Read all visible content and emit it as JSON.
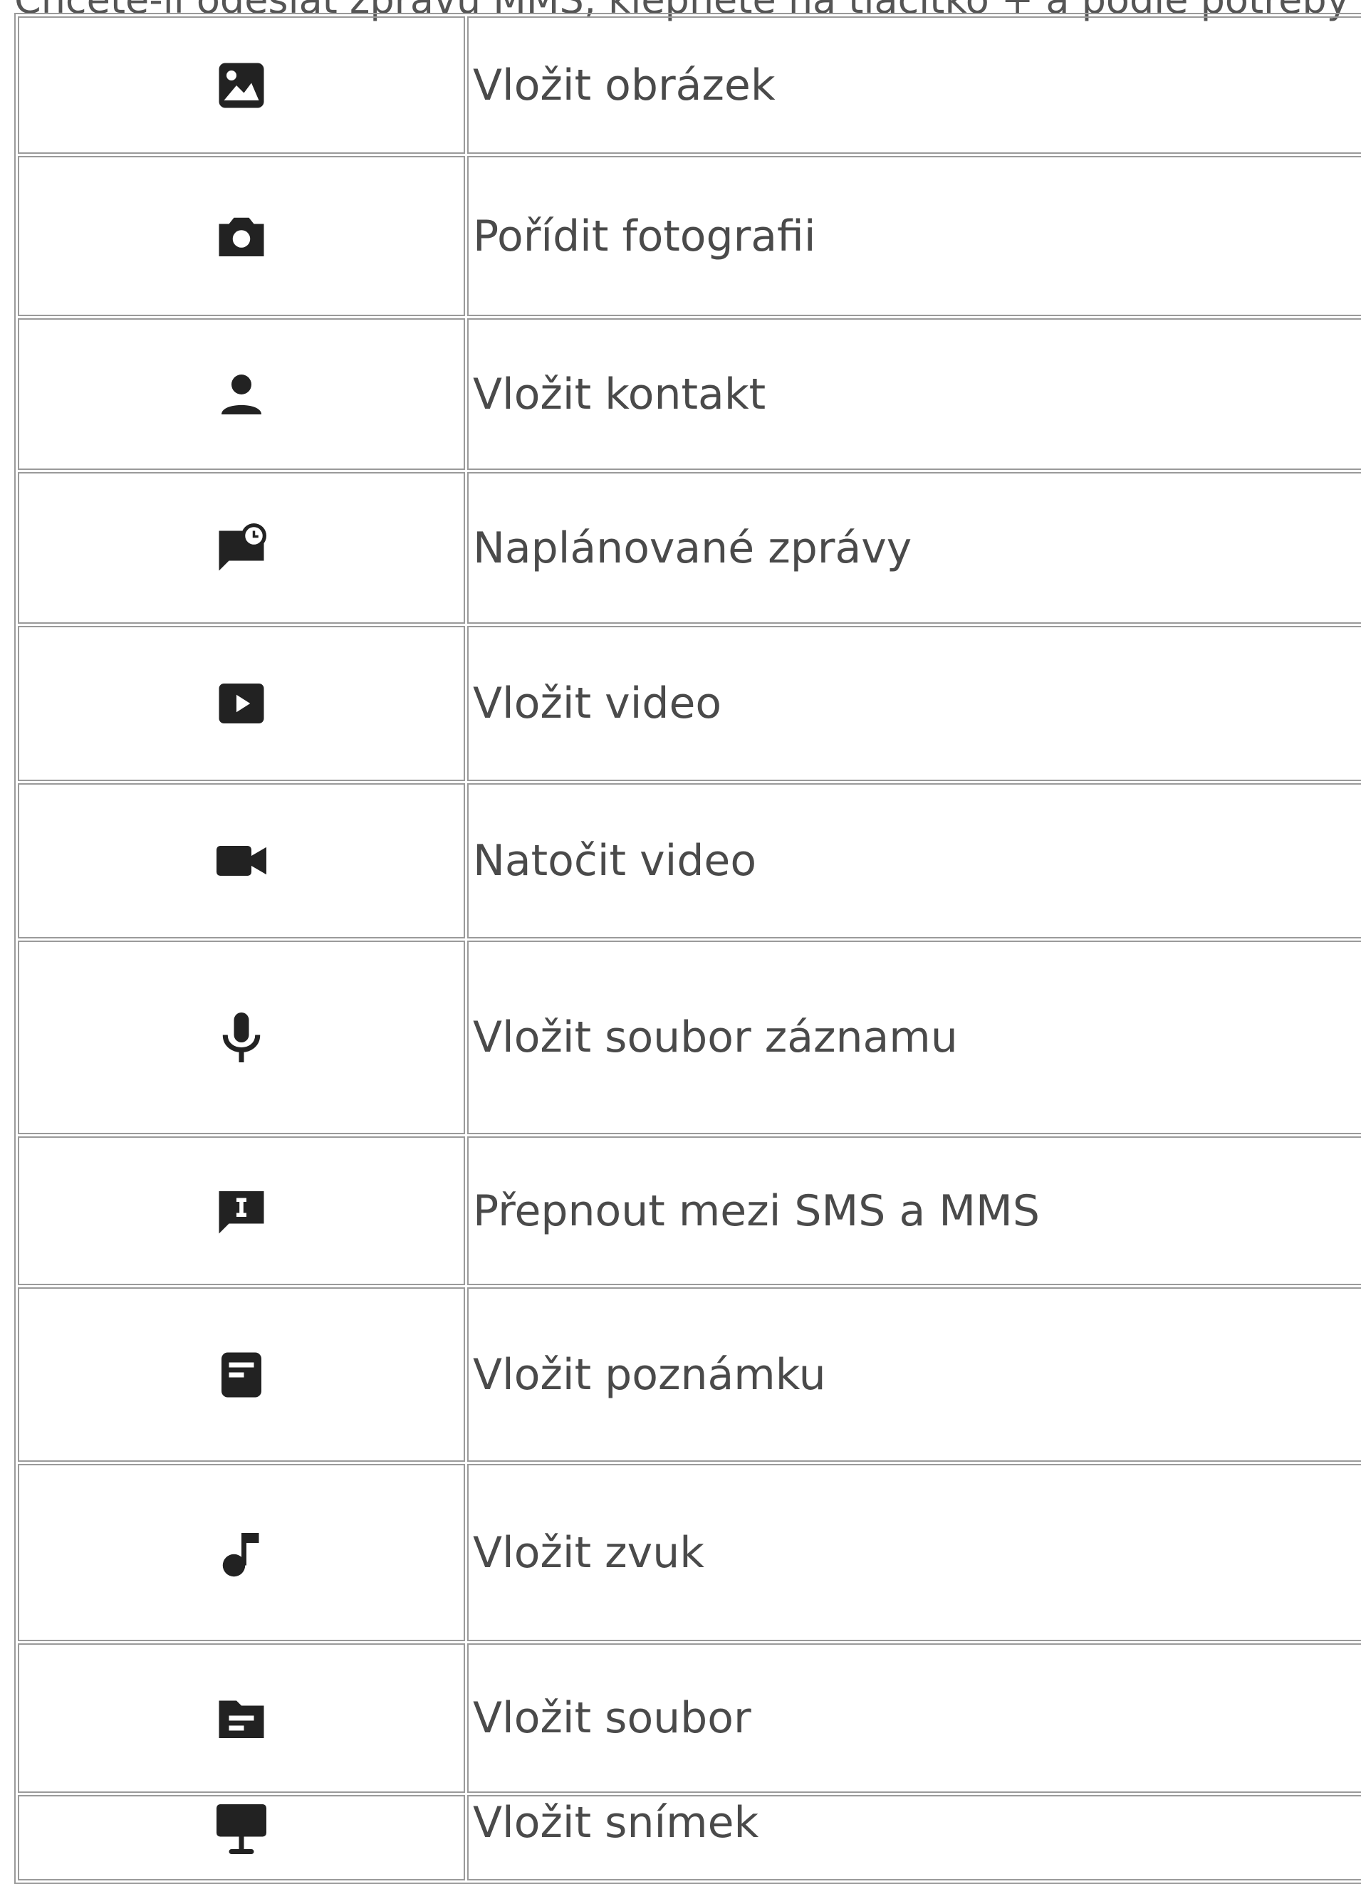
{
  "intro_text": "Chcete-li odeslat zprávu MMS, klepněte na tlačítko + a podle potřeby",
  "rows": [
    {
      "icon": "image-icon",
      "label": "Vložit obrázek"
    },
    {
      "icon": "camera-icon",
      "label": "Pořídit fotografii"
    },
    {
      "icon": "person-icon",
      "label": "Vložit kontakt"
    },
    {
      "icon": "scheduled-message-icon",
      "label": "Naplánované zprávy"
    },
    {
      "icon": "video-play-icon",
      "label": "Vložit video"
    },
    {
      "icon": "videocam-icon",
      "label": "Natočit video"
    },
    {
      "icon": "microphone-icon",
      "label": "Vložit soubor záznamu"
    },
    {
      "icon": "sms-mms-switch-icon",
      "label": "Přepnout mezi SMS a MMS"
    },
    {
      "icon": "note-icon",
      "label": "Vložit poznámku"
    },
    {
      "icon": "music-note-icon",
      "label": "Vložit zvuk"
    },
    {
      "icon": "folder-icon",
      "label": "Vložit soubor"
    },
    {
      "icon": "slide-icon",
      "label": "Vložit snímek"
    }
  ],
  "colors": {
    "icon": "#222222",
    "text": "#4a4a4a",
    "border": "#9a9a9a"
  }
}
